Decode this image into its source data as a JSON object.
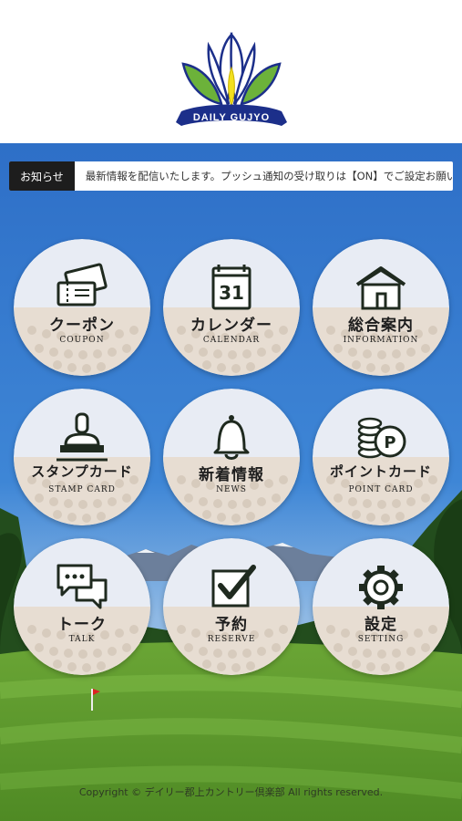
{
  "logo": {
    "text": "DAILY GUJYO"
  },
  "ticker": {
    "label": "お知らせ",
    "message": "最新情報を配信いたします。プッシュ通知の受け取りは【ON】でご設定お願いします。"
  },
  "menu": [
    {
      "jp": "クーポン",
      "en": "COUPON",
      "icon": "coupon-icon"
    },
    {
      "jp": "カレンダー",
      "en": "CALENDAR",
      "icon": "calendar-icon",
      "icon_text": "31"
    },
    {
      "jp": "総合案内",
      "en": "INFORMATION",
      "icon": "house-icon"
    },
    {
      "jp": "スタンプカード",
      "en": "STAMP CARD",
      "icon": "stamp-icon"
    },
    {
      "jp": "新着情報",
      "en": "NEWS",
      "icon": "bell-icon"
    },
    {
      "jp": "ポイントカード",
      "en": "POINT CARD",
      "icon": "coins-icon",
      "icon_text": "P"
    },
    {
      "jp": "トーク",
      "en": "TALK",
      "icon": "chat-icon"
    },
    {
      "jp": "予約",
      "en": "RESERVE",
      "icon": "checkbox-icon"
    },
    {
      "jp": "設定",
      "en": "SETTING",
      "icon": "gear-icon"
    }
  ],
  "footer": {
    "copyright": "Copyright © デイリー郡上カントリー倶楽部 All rights reserved."
  },
  "colors": {
    "sky": "#2f72c8",
    "grass": "#6aa535",
    "ticker_tag": "#1d1d1d",
    "logo_blue": "#1c2f8a",
    "leaf_green": "#6cb23a"
  }
}
